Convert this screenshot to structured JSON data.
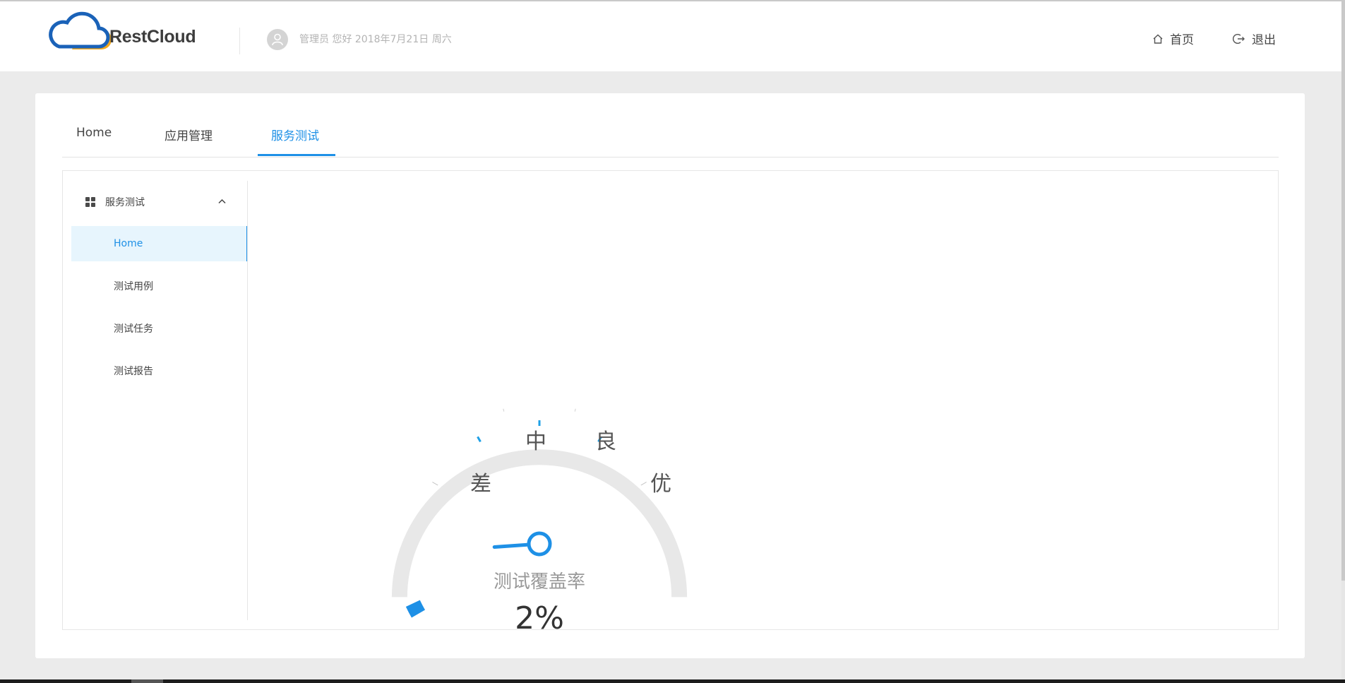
{
  "header": {
    "logo_text": "RestCloud",
    "greeting": "管理员 您好 2018年7月21日 周六",
    "nav_home": "首页",
    "nav_logout": "退出"
  },
  "tabs": [
    "Home",
    "应用管理",
    "服务测试"
  ],
  "active_tab": "服务测试",
  "sidebar": {
    "group_title": "服务测试",
    "items": [
      "Home",
      "测试用例",
      "测试任务",
      "测试报告"
    ],
    "active_item": "Home"
  },
  "gauge": {
    "title": "测试覆盖率",
    "value": 2,
    "value_text": "2%",
    "max": 100,
    "grades": [
      "差",
      "中",
      "良",
      "优"
    ]
  },
  "colors": {
    "accent": "#1e90e6",
    "gauge_track": "#e8e8e8",
    "active_item_bg": "#e7f5fd",
    "page_bg": "#ebebeb"
  }
}
